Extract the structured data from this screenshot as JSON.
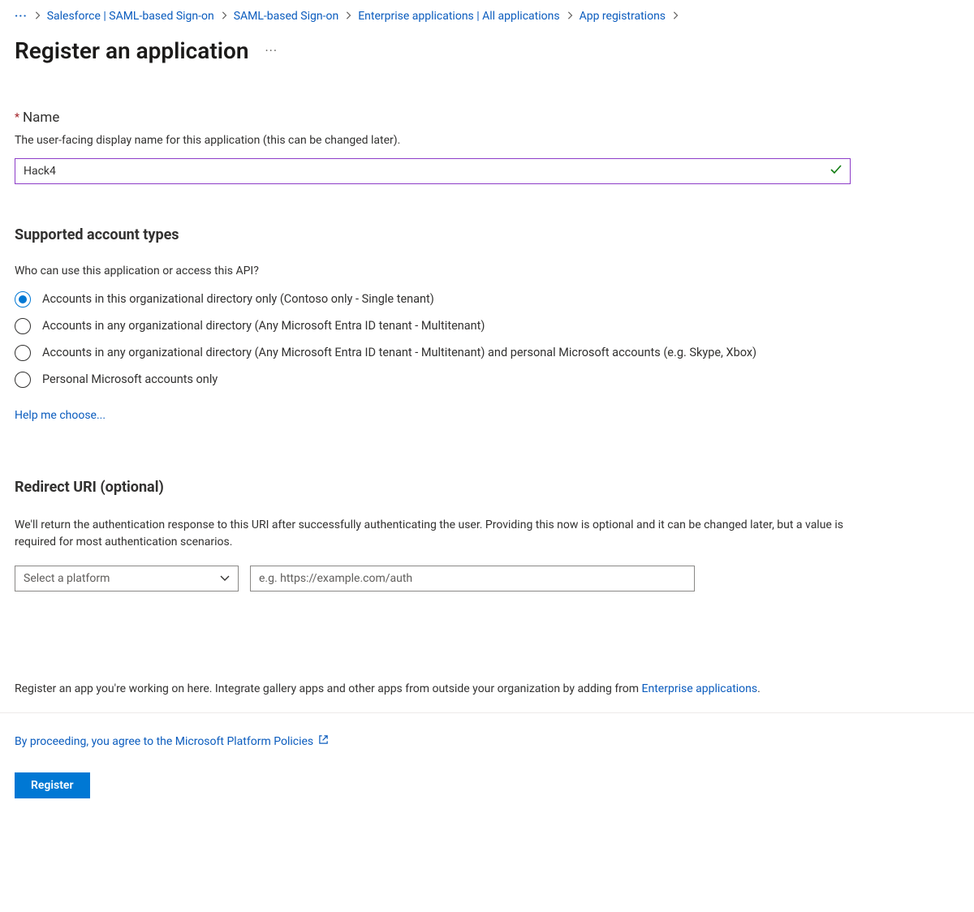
{
  "breadcrumb": {
    "overflow": "···",
    "items": [
      "Salesforce | SAML-based Sign-on",
      "SAML-based Sign-on",
      "Enterprise applications | All applications",
      "App registrations"
    ]
  },
  "page": {
    "title": "Register an application",
    "more": "···"
  },
  "name_field": {
    "required_star": "*",
    "label": "Name",
    "help": "The user-facing display name for this application (this can be changed later).",
    "value": "Hack4"
  },
  "account_types": {
    "title": "Supported account types",
    "question": "Who can use this application or access this API?",
    "options": [
      {
        "label": "Accounts in this organizational directory only (Contoso only - Single tenant)",
        "selected": true
      },
      {
        "label": "Accounts in any organizational directory (Any Microsoft Entra ID tenant - Multitenant)",
        "selected": false
      },
      {
        "label": "Accounts in any organizational directory (Any Microsoft Entra ID tenant - Multitenant) and personal Microsoft accounts (e.g. Skype, Xbox)",
        "selected": false
      },
      {
        "label": "Personal Microsoft accounts only",
        "selected": false
      }
    ],
    "help_link": "Help me choose..."
  },
  "redirect_uri": {
    "title": "Redirect URI (optional)",
    "description": "We'll return the authentication response to this URI after successfully authenticating the user. Providing this now is optional and it can be changed later, but a value is required for most authentication scenarios.",
    "platform_placeholder": "Select a platform",
    "uri_placeholder": "e.g. https://example.com/auth"
  },
  "footer": {
    "note_prefix": "Register an app you're working on here. Integrate gallery apps and other apps from outside your organization by adding from ",
    "note_link": "Enterprise applications",
    "note_suffix": ".",
    "policies_text": "By proceeding, you agree to the Microsoft Platform Policies",
    "register_label": "Register"
  }
}
